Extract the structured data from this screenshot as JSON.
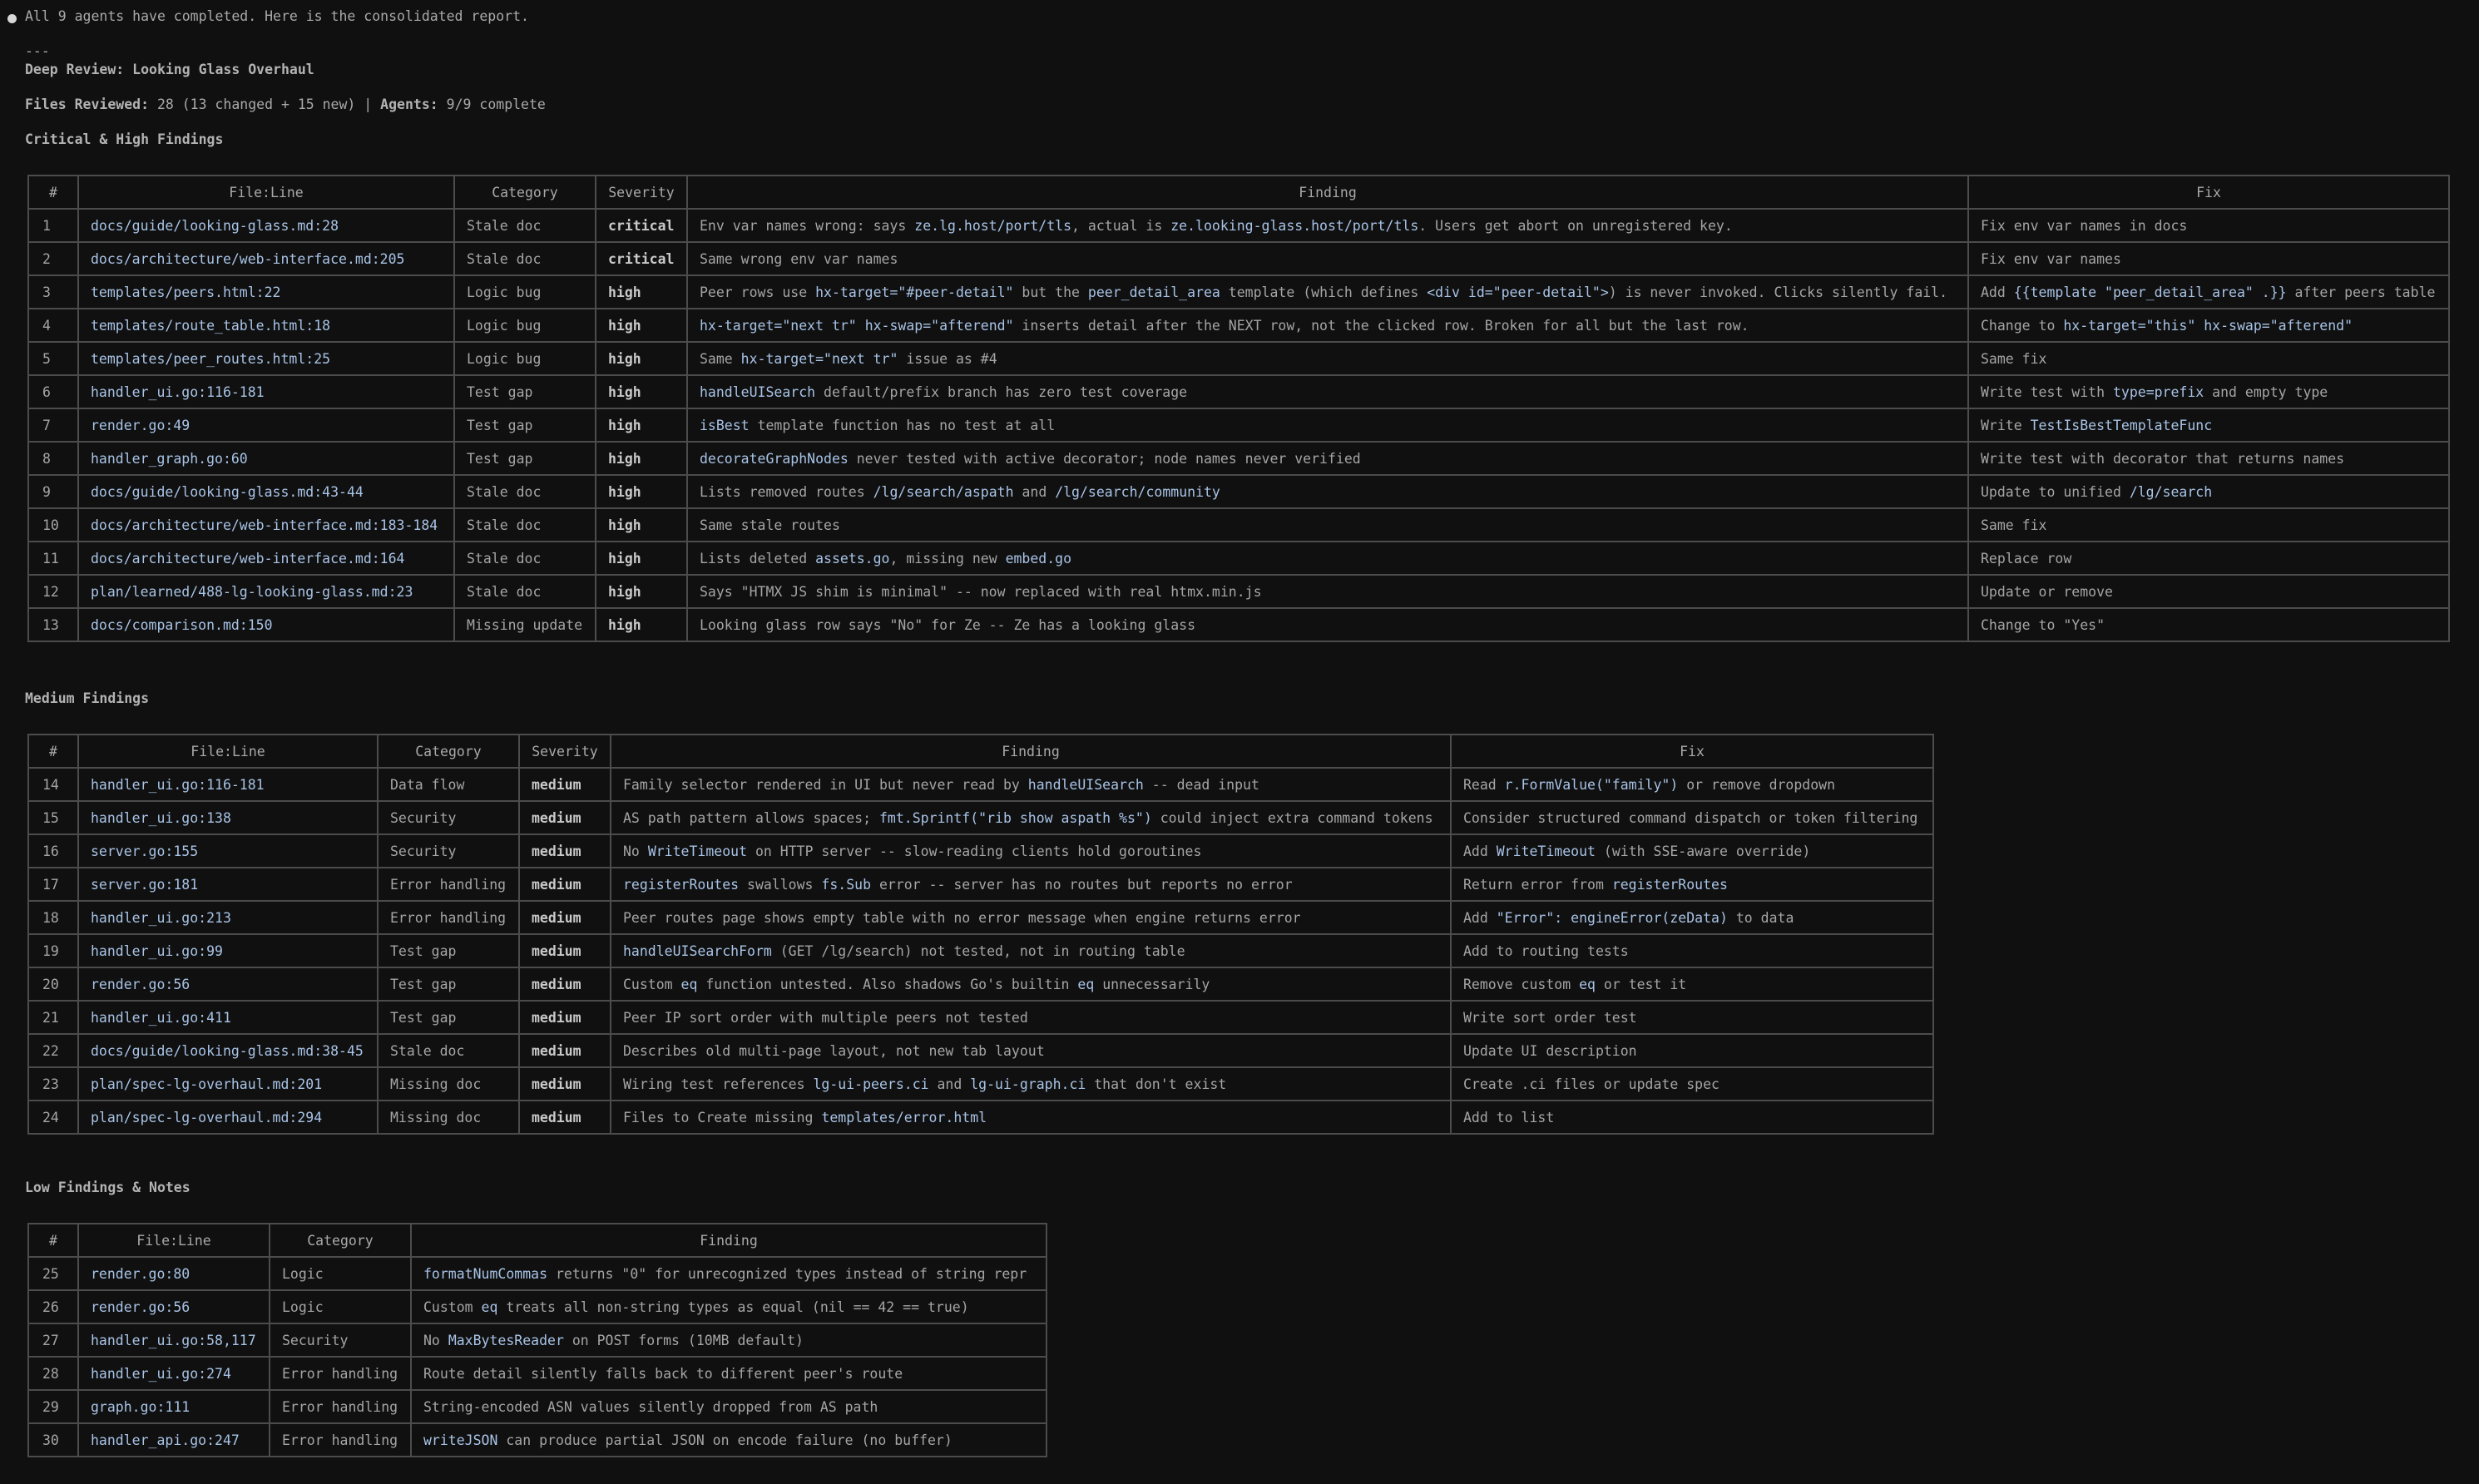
{
  "status_line": "All 9 agents have completed. Here is the consolidated report.",
  "separator": "---",
  "report_title": "Deep Review: Looking Glass Overhaul",
  "summary": {
    "files_label": "Files Reviewed:",
    "files_value": " 28 (13 changed + 15 new) | ",
    "agents_label": "Agents:",
    "agents_value": " 9/9 complete"
  },
  "sections": {
    "critical_high": "Critical & High Findings",
    "medium": "Medium Findings",
    "low": "Low Findings & Notes"
  },
  "headers": {
    "num": "#",
    "file_line": "File:Line",
    "category": "Category",
    "severity": "Severity",
    "finding": "Finding",
    "fix": "Fix"
  },
  "critical_high_rows": [
    {
      "num": "1",
      "file": "docs/guide/looking-glass.md:28",
      "category": "Stale doc",
      "severity": "critical",
      "finding": [
        [
          "t",
          "Env var names wrong: says "
        ],
        [
          "c",
          "ze.lg.host/port/tls"
        ],
        [
          "t",
          ", actual is "
        ],
        [
          "c",
          "ze.looking-glass.host/port/tls"
        ],
        [
          "t",
          ". Users get abort on unregistered key."
        ]
      ],
      "fix": [
        [
          "t",
          "Fix env var names in docs"
        ]
      ]
    },
    {
      "num": "2",
      "file": "docs/architecture/web-interface.md:205",
      "category": "Stale doc",
      "severity": "critical",
      "finding": [
        [
          "t",
          "Same wrong env var names"
        ]
      ],
      "fix": [
        [
          "t",
          "Fix env var names"
        ]
      ]
    },
    {
      "num": "3",
      "file": "templates/peers.html:22",
      "category": "Logic bug",
      "severity": "high",
      "finding": [
        [
          "t",
          "Peer rows use "
        ],
        [
          "c",
          "hx-target=\"#peer-detail\""
        ],
        [
          "t",
          " but the "
        ],
        [
          "c",
          "peer_detail_area"
        ],
        [
          "t",
          " template (which defines "
        ],
        [
          "c",
          "<div id=\"peer-detail\">"
        ],
        [
          "t",
          ") is never invoked. Clicks silently fail."
        ]
      ],
      "fix": [
        [
          "t",
          "Add "
        ],
        [
          "c",
          "{{template \"peer_detail_area\" .}}"
        ],
        [
          "t",
          " after peers table"
        ]
      ]
    },
    {
      "num": "4",
      "file": "templates/route_table.html:18",
      "category": "Logic bug",
      "severity": "high",
      "finding": [
        [
          "c",
          "hx-target=\"next tr\""
        ],
        [
          "t",
          " "
        ],
        [
          "c",
          "hx-swap=\"afterend\""
        ],
        [
          "t",
          " inserts detail after the NEXT row, not the clicked row. Broken for all but the last row."
        ]
      ],
      "fix": [
        [
          "t",
          "Change to "
        ],
        [
          "c",
          "hx-target=\"this\""
        ],
        [
          "t",
          " "
        ],
        [
          "c",
          "hx-swap=\"afterend\""
        ]
      ]
    },
    {
      "num": "5",
      "file": "templates/peer_routes.html:25",
      "category": "Logic bug",
      "severity": "high",
      "finding": [
        [
          "t",
          "Same "
        ],
        [
          "c",
          "hx-target=\"next tr\""
        ],
        [
          "t",
          " issue as #4"
        ]
      ],
      "fix": [
        [
          "t",
          "Same fix"
        ]
      ]
    },
    {
      "num": "6",
      "file": "handler_ui.go:116-181",
      "category": "Test gap",
      "severity": "high",
      "finding": [
        [
          "c",
          "handleUISearch"
        ],
        [
          "t",
          " default/prefix branch has zero test coverage"
        ]
      ],
      "fix": [
        [
          "t",
          "Write test with "
        ],
        [
          "c",
          "type=prefix"
        ],
        [
          "t",
          " and empty type"
        ]
      ]
    },
    {
      "num": "7",
      "file": "render.go:49",
      "category": "Test gap",
      "severity": "high",
      "finding": [
        [
          "c",
          "isBest"
        ],
        [
          "t",
          " template function has no test at all"
        ]
      ],
      "fix": [
        [
          "t",
          "Write "
        ],
        [
          "c",
          "TestIsBestTemplateFunc"
        ]
      ]
    },
    {
      "num": "8",
      "file": "handler_graph.go:60",
      "category": "Test gap",
      "severity": "high",
      "finding": [
        [
          "c",
          "decorateGraphNodes"
        ],
        [
          "t",
          " never tested with active decorator; node names never verified"
        ]
      ],
      "fix": [
        [
          "t",
          "Write test with decorator that returns names"
        ]
      ]
    },
    {
      "num": "9",
      "file": "docs/guide/looking-glass.md:43-44",
      "category": "Stale doc",
      "severity": "high",
      "finding": [
        [
          "t",
          "Lists removed routes "
        ],
        [
          "c",
          "/lg/search/aspath"
        ],
        [
          "t",
          " and "
        ],
        [
          "c",
          "/lg/search/community"
        ]
      ],
      "fix": [
        [
          "t",
          "Update to unified "
        ],
        [
          "c",
          "/lg/search"
        ]
      ]
    },
    {
      "num": "10",
      "file": "docs/architecture/web-interface.md:183-184",
      "category": "Stale doc",
      "severity": "high",
      "finding": [
        [
          "t",
          "Same stale routes"
        ]
      ],
      "fix": [
        [
          "t",
          "Same fix"
        ]
      ]
    },
    {
      "num": "11",
      "file": "docs/architecture/web-interface.md:164",
      "category": "Stale doc",
      "severity": "high",
      "finding": [
        [
          "t",
          "Lists deleted "
        ],
        [
          "c",
          "assets.go"
        ],
        [
          "t",
          ", missing new "
        ],
        [
          "c",
          "embed.go"
        ]
      ],
      "fix": [
        [
          "t",
          "Replace row"
        ]
      ]
    },
    {
      "num": "12",
      "file": "plan/learned/488-lg-looking-glass.md:23",
      "category": "Stale doc",
      "severity": "high",
      "finding": [
        [
          "t",
          "Says \"HTMX JS shim is minimal\" -- now replaced with real htmx.min.js"
        ]
      ],
      "fix": [
        [
          "t",
          "Update or remove"
        ]
      ]
    },
    {
      "num": "13",
      "file": "docs/comparison.md:150",
      "category": "Missing update",
      "severity": "high",
      "finding": [
        [
          "t",
          "Looking glass row says \"No\" for Ze -- Ze has a looking glass"
        ]
      ],
      "fix": [
        [
          "t",
          "Change to \"Yes\""
        ]
      ]
    }
  ],
  "medium_rows": [
    {
      "num": "14",
      "file": "handler_ui.go:116-181",
      "category": "Data flow",
      "severity": "medium",
      "finding": [
        [
          "t",
          "Family selector rendered in UI but never read by "
        ],
        [
          "c",
          "handleUISearch"
        ],
        [
          "t",
          " -- dead input"
        ]
      ],
      "fix": [
        [
          "t",
          "Read "
        ],
        [
          "c",
          "r.FormValue(\"family\")"
        ],
        [
          "t",
          " or remove dropdown"
        ]
      ]
    },
    {
      "num": "15",
      "file": "handler_ui.go:138",
      "category": "Security",
      "severity": "medium",
      "finding": [
        [
          "t",
          "AS path pattern allows spaces; "
        ],
        [
          "c",
          "fmt.Sprintf(\"rib show aspath %s\")"
        ],
        [
          "t",
          " could inject extra command tokens"
        ]
      ],
      "fix": [
        [
          "t",
          "Consider structured command dispatch or token filtering"
        ]
      ]
    },
    {
      "num": "16",
      "file": "server.go:155",
      "category": "Security",
      "severity": "medium",
      "finding": [
        [
          "t",
          "No "
        ],
        [
          "c",
          "WriteTimeout"
        ],
        [
          "t",
          " on HTTP server -- slow-reading clients hold goroutines"
        ]
      ],
      "fix": [
        [
          "t",
          "Add "
        ],
        [
          "c",
          "WriteTimeout"
        ],
        [
          "t",
          " (with SSE-aware override)"
        ]
      ]
    },
    {
      "num": "17",
      "file": "server.go:181",
      "category": "Error handling",
      "severity": "medium",
      "finding": [
        [
          "c",
          "registerRoutes"
        ],
        [
          "t",
          " swallows "
        ],
        [
          "c",
          "fs.Sub"
        ],
        [
          "t",
          " error -- server has no routes but reports no error"
        ]
      ],
      "fix": [
        [
          "t",
          "Return error from "
        ],
        [
          "c",
          "registerRoutes"
        ]
      ]
    },
    {
      "num": "18",
      "file": "handler_ui.go:213",
      "category": "Error handling",
      "severity": "medium",
      "finding": [
        [
          "t",
          "Peer routes page shows empty table with no error message when engine returns error"
        ]
      ],
      "fix": [
        [
          "t",
          "Add "
        ],
        [
          "c",
          "\"Error\": engineError(zeData)"
        ],
        [
          "t",
          " to data"
        ]
      ]
    },
    {
      "num": "19",
      "file": "handler_ui.go:99",
      "category": "Test gap",
      "severity": "medium",
      "finding": [
        [
          "c",
          "handleUISearchForm"
        ],
        [
          "t",
          " (GET /lg/search) not tested, not in routing table"
        ]
      ],
      "fix": [
        [
          "t",
          "Add to routing tests"
        ]
      ]
    },
    {
      "num": "20",
      "file": "render.go:56",
      "category": "Test gap",
      "severity": "medium",
      "finding": [
        [
          "t",
          "Custom "
        ],
        [
          "c",
          "eq"
        ],
        [
          "t",
          " function untested. Also shadows Go's builtin "
        ],
        [
          "c",
          "eq"
        ],
        [
          "t",
          " unnecessarily"
        ]
      ],
      "fix": [
        [
          "t",
          "Remove custom "
        ],
        [
          "c",
          "eq"
        ],
        [
          "t",
          " or test it"
        ]
      ]
    },
    {
      "num": "21",
      "file": "handler_ui.go:411",
      "category": "Test gap",
      "severity": "medium",
      "finding": [
        [
          "t",
          "Peer IP sort order with multiple peers not tested"
        ]
      ],
      "fix": [
        [
          "t",
          "Write sort order test"
        ]
      ]
    },
    {
      "num": "22",
      "file": "docs/guide/looking-glass.md:38-45",
      "category": "Stale doc",
      "severity": "medium",
      "finding": [
        [
          "t",
          "Describes old multi-page layout, not new tab layout"
        ]
      ],
      "fix": [
        [
          "t",
          "Update UI description"
        ]
      ]
    },
    {
      "num": "23",
      "file": "plan/spec-lg-overhaul.md:201",
      "category": "Missing doc",
      "severity": "medium",
      "finding": [
        [
          "t",
          "Wiring test references "
        ],
        [
          "c",
          "lg-ui-peers.ci"
        ],
        [
          "t",
          " and "
        ],
        [
          "c",
          "lg-ui-graph.ci"
        ],
        [
          "t",
          " that don't exist"
        ]
      ],
      "fix": [
        [
          "t",
          "Create .ci files or update spec"
        ]
      ]
    },
    {
      "num": "24",
      "file": "plan/spec-lg-overhaul.md:294",
      "category": "Missing doc",
      "severity": "medium",
      "finding": [
        [
          "t",
          "Files to Create missing "
        ],
        [
          "c",
          "templates/error.html"
        ]
      ],
      "fix": [
        [
          "t",
          "Add to list"
        ]
      ]
    }
  ],
  "low_rows": [
    {
      "num": "25",
      "file": "render.go:80",
      "category": "Logic",
      "finding": [
        [
          "c",
          "formatNumCommas"
        ],
        [
          "t",
          " returns \"0\" for unrecognized types instead of string repr"
        ]
      ]
    },
    {
      "num": "26",
      "file": "render.go:56",
      "category": "Logic",
      "finding": [
        [
          "t",
          "Custom "
        ],
        [
          "c",
          "eq"
        ],
        [
          "t",
          " treats all non-string types as equal (nil == 42 == true)"
        ]
      ]
    },
    {
      "num": "27",
      "file": "handler_ui.go:58,117",
      "category": "Security",
      "finding": [
        [
          "t",
          "No "
        ],
        [
          "c",
          "MaxBytesReader"
        ],
        [
          "t",
          " on POST forms (10MB default)"
        ]
      ]
    },
    {
      "num": "28",
      "file": "handler_ui.go:274",
      "category": "Error handling",
      "finding": [
        [
          "t",
          "Route detail silently falls back to different peer's route"
        ]
      ]
    },
    {
      "num": "29",
      "file": "graph.go:111",
      "category": "Error handling",
      "finding": [
        [
          "t",
          "String-encoded ASN values silently dropped from AS path"
        ]
      ]
    },
    {
      "num": "30",
      "file": "handler_api.go:247",
      "category": "Error handling",
      "finding": [
        [
          "c",
          "writeJSON"
        ],
        [
          "t",
          " can produce partial JSON on encode failure (no buffer)"
        ]
      ]
    }
  ]
}
